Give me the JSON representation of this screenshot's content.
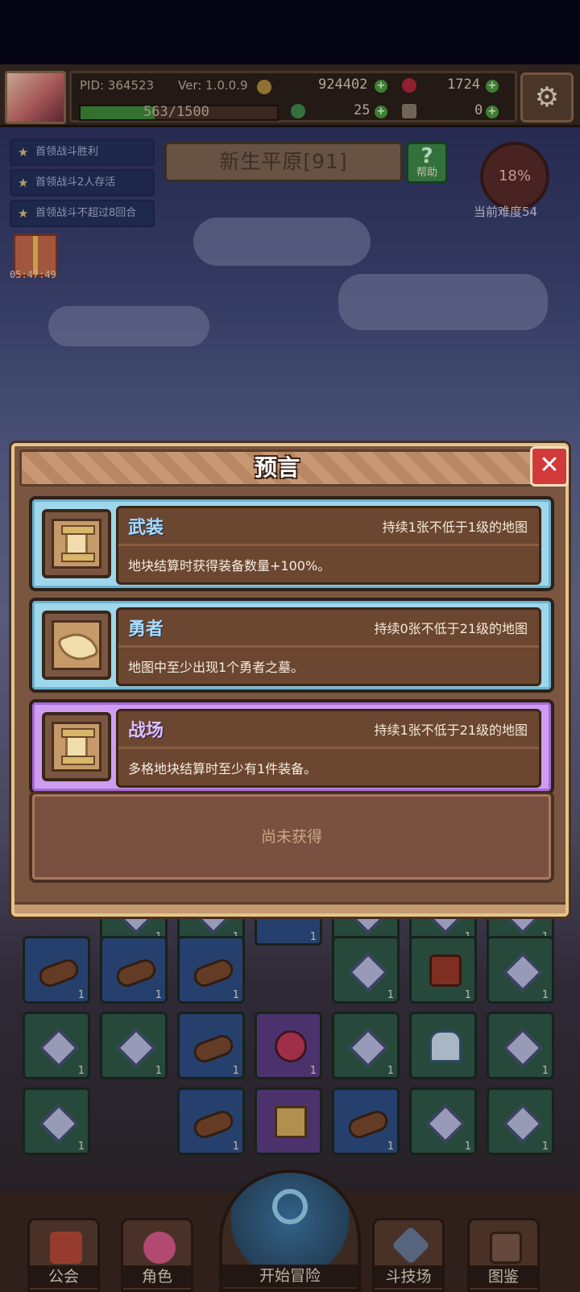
{
  "hud": {
    "pid": "PID: 364523",
    "version": "Ver: 1.0.0.9",
    "gold": "924402",
    "gems": "1724",
    "clovers": "25",
    "keys": "0",
    "xp_text": "563/1500",
    "xp_fraction": 0.375
  },
  "quests": [
    "首领战斗胜利",
    "首领战斗2人存活",
    "首领战斗不超过8回合"
  ],
  "gift_timer": "05:47:49",
  "map": {
    "name": "新生平原[91]",
    "help_label": "帮助",
    "progress": "18%",
    "difficulty": "当前难度54"
  },
  "grid_counts": [
    "1",
    "1",
    "1",
    "1",
    "1",
    "1",
    "1",
    "1",
    "1",
    "1",
    "1",
    "1",
    "1",
    "1",
    "1",
    "1",
    "1",
    "1",
    "1",
    "1",
    "1",
    "1"
  ],
  "modal": {
    "title": "预言",
    "close": "✕",
    "cards": [
      {
        "name": "武装",
        "duration": "持续1张不低于1级的地图",
        "desc": "地块结算时获得装备数量+100%。"
      },
      {
        "name": "勇者",
        "duration": "持续0张不低于21级的地图",
        "desc": "地图中至少出现1个勇者之墓。"
      },
      {
        "name": "战场",
        "duration": "持续1张不低于21级的地图",
        "desc": "多格地块结算时至少有1件装备。"
      }
    ],
    "empty_label": "尚未获得"
  },
  "nav": {
    "guild": "公会",
    "character": "角色",
    "start": "开始冒险",
    "arena": "斗技场",
    "codex": "图鉴"
  },
  "colors": {
    "cyan_card": "#9ed6ea",
    "violet_card": "#cf9df0",
    "close_red": "#d23a3a"
  }
}
